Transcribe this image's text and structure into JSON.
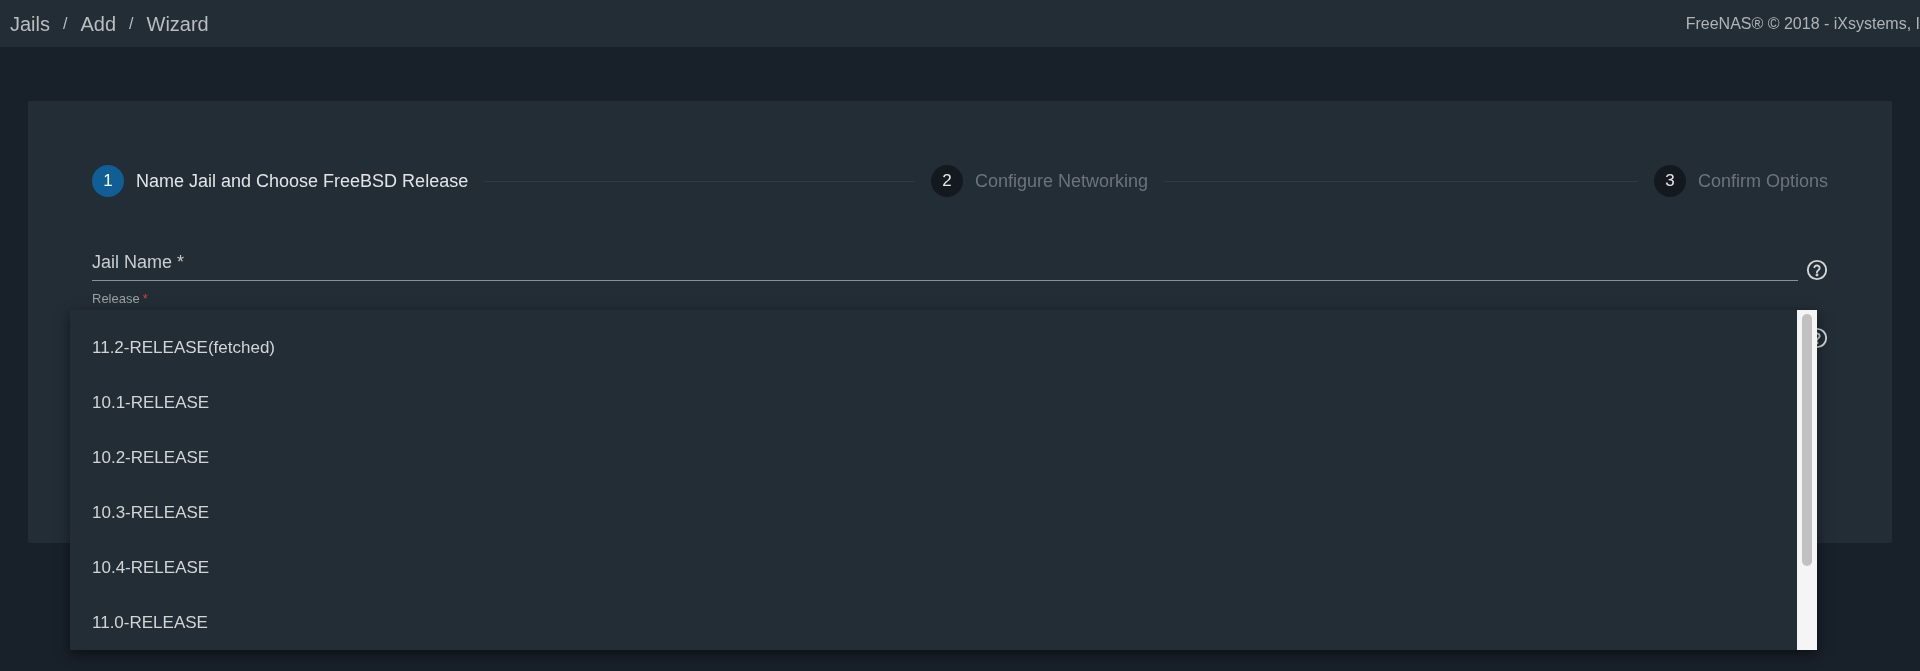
{
  "breadcrumb": [
    "Jails",
    "Add",
    "Wizard"
  ],
  "breadcrumb_separator": "/",
  "copyright": "FreeNAS® © 2018 - iXsystems, I",
  "steps": [
    {
      "number": "1",
      "label": "Name Jail and Choose FreeBSD Release",
      "selected": true
    },
    {
      "number": "2",
      "label": "Configure Networking",
      "selected": false
    },
    {
      "number": "3",
      "label": "Confirm Options",
      "selected": false
    }
  ],
  "jail_name": {
    "placeholder": "Jail Name *"
  },
  "release": {
    "label": "Release",
    "required_mark": "*"
  },
  "release_options": [
    "11.2-RELEASE(fetched)",
    "10.1-RELEASE",
    "10.2-RELEASE",
    "10.3-RELEASE",
    "10.4-RELEASE",
    "11.0-RELEASE"
  ]
}
